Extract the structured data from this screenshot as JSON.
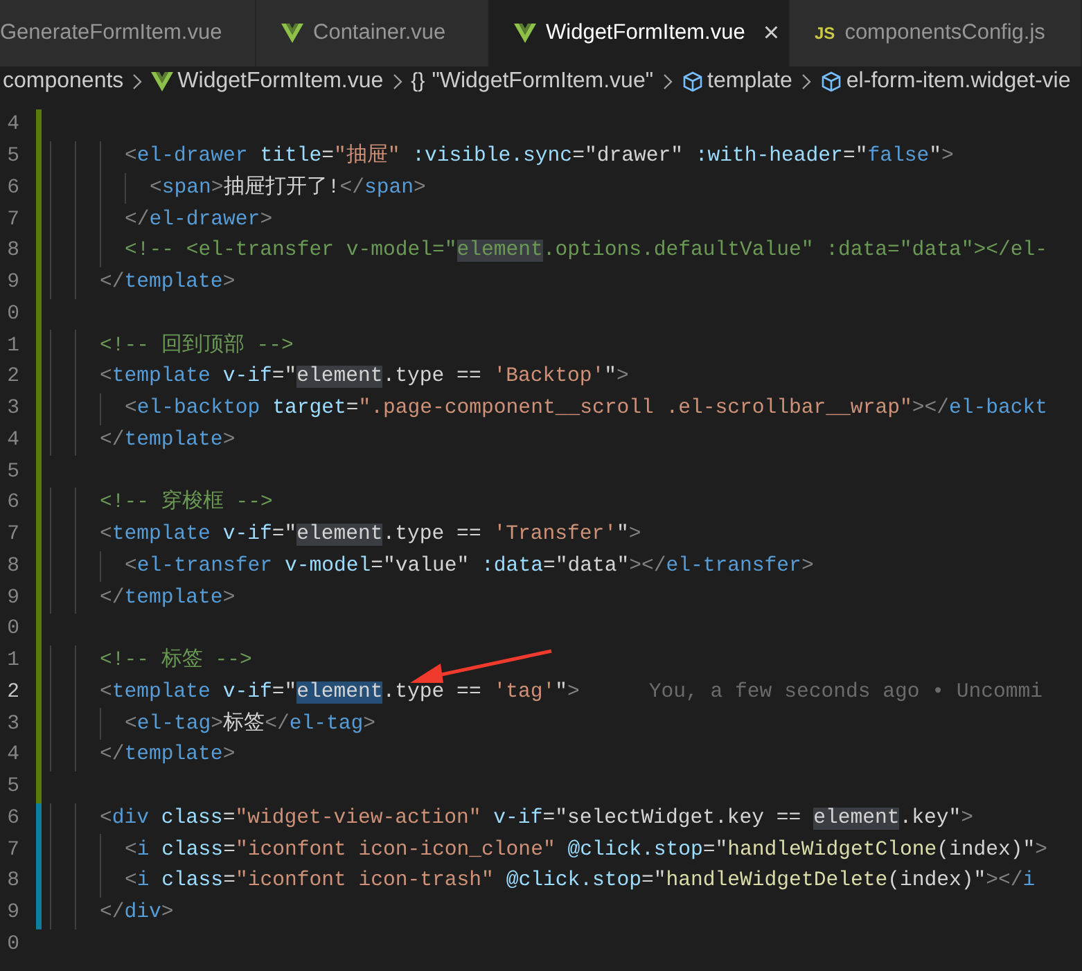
{
  "tabs": [
    {
      "label": "GenerateFormItem.vue",
      "kind": "plain",
      "selected": false
    },
    {
      "label": "Container.vue",
      "kind": "vue",
      "selected": false
    },
    {
      "label": "WidgetFormItem.vue",
      "kind": "vue",
      "selected": true,
      "close": "×"
    },
    {
      "label": "componentsConfig.js",
      "kind": "js",
      "icon_text": "JS",
      "selected": false
    }
  ],
  "breadcrumbs": [
    {
      "label": "components",
      "kind": "plain"
    },
    {
      "label": "WidgetFormItem.vue",
      "kind": "vue"
    },
    {
      "label": "\"WidgetFormItem.vue\"",
      "kind": "text",
      "icon_text": "{}"
    },
    {
      "label": "template",
      "kind": "cube"
    },
    {
      "label": "el-form-item.widget-vie",
      "kind": "cube"
    }
  ],
  "lines": [
    {
      "number": "4",
      "added": true,
      "modified": false,
      "current": false
    },
    {
      "number": "5",
      "added": true,
      "modified": false,
      "current": false,
      "tokens": [
        {
          "kind": "punct",
          "text": "      <"
        },
        {
          "kind": "tag",
          "text": "el-drawer"
        },
        {
          "kind": "attr",
          "text": " title"
        },
        {
          "kind": "text",
          "text": "="
        },
        {
          "kind": "str",
          "text": "\"抽屉\""
        },
        {
          "kind": "attr",
          "text": " :visible.sync"
        },
        {
          "kind": "text",
          "text": "=\"drawer\""
        },
        {
          "kind": "attr",
          "text": " :with-header"
        },
        {
          "kind": "text",
          "text": "=\""
        },
        {
          "kind": "kw",
          "text": "false"
        },
        {
          "kind": "text",
          "text": "\""
        },
        {
          "kind": "punct",
          "text": ">"
        }
      ]
    },
    {
      "number": "6",
      "added": true,
      "modified": false,
      "current": false,
      "tokens": [
        {
          "kind": "punct",
          "text": "        <"
        },
        {
          "kind": "tag",
          "text": "span"
        },
        {
          "kind": "punct",
          "text": ">"
        },
        {
          "kind": "text",
          "text": "抽屉打开了!"
        },
        {
          "kind": "punct",
          "text": "</"
        },
        {
          "kind": "tag",
          "text": "span"
        },
        {
          "kind": "punct",
          "text": ">"
        }
      ]
    },
    {
      "number": "7",
      "added": true,
      "modified": false,
      "current": false,
      "tokens": [
        {
          "kind": "punct",
          "text": "      </"
        },
        {
          "kind": "tag",
          "text": "el-drawer"
        },
        {
          "kind": "punct",
          "text": ">"
        }
      ]
    },
    {
      "number": "8",
      "added": true,
      "modified": false,
      "current": false,
      "tokens": [
        {
          "kind": "cmt",
          "text": "      <!-- <el-transfer v-model=\""
        },
        {
          "kind": "cmt",
          "text": "element",
          "highlighted": true,
          "selected": false
        },
        {
          "kind": "cmt",
          "text": ".options.defaultValue\" :data=\"data\"></el-"
        }
      ]
    },
    {
      "number": "9",
      "added": true,
      "modified": false,
      "current": false,
      "tokens": [
        {
          "kind": "punct",
          "text": "    </"
        },
        {
          "kind": "tag",
          "text": "template"
        },
        {
          "kind": "punct",
          "text": ">"
        }
      ]
    },
    {
      "number": "0",
      "added": true,
      "modified": false,
      "current": false
    },
    {
      "number": "1",
      "added": true,
      "modified": false,
      "current": false,
      "tokens": [
        {
          "kind": "cmt",
          "text": "    <!-- 回到顶部 -->"
        }
      ]
    },
    {
      "number": "2",
      "added": true,
      "modified": false,
      "current": false,
      "tokens": [
        {
          "kind": "punct",
          "text": "    <"
        },
        {
          "kind": "tag",
          "text": "template"
        },
        {
          "kind": "attr",
          "text": " v-if"
        },
        {
          "kind": "text",
          "text": "=\""
        },
        {
          "kind": "text",
          "text": "element",
          "highlighted": true,
          "selected": false
        },
        {
          "kind": "text",
          "text": ".type == "
        },
        {
          "kind": "str",
          "text": "'Backtop'"
        },
        {
          "kind": "text",
          "text": "\""
        },
        {
          "kind": "punct",
          "text": ">"
        }
      ]
    },
    {
      "number": "3",
      "added": true,
      "modified": false,
      "current": false,
      "tokens": [
        {
          "kind": "punct",
          "text": "      <"
        },
        {
          "kind": "tag",
          "text": "el-backtop"
        },
        {
          "kind": "attr",
          "text": " target"
        },
        {
          "kind": "text",
          "text": "="
        },
        {
          "kind": "str",
          "text": "\".page-component__scroll .el-scrollbar__wrap\""
        },
        {
          "kind": "punct",
          "text": "></"
        },
        {
          "kind": "tag",
          "text": "el-backt"
        }
      ]
    },
    {
      "number": "4",
      "added": true,
      "modified": false,
      "current": false,
      "tokens": [
        {
          "kind": "punct",
          "text": "    </"
        },
        {
          "kind": "tag",
          "text": "template"
        },
        {
          "kind": "punct",
          "text": ">"
        }
      ]
    },
    {
      "number": "5",
      "added": true,
      "modified": false,
      "current": false
    },
    {
      "number": "6",
      "added": true,
      "modified": false,
      "current": false,
      "tokens": [
        {
          "kind": "cmt",
          "text": "    <!-- 穿梭框 -->"
        }
      ]
    },
    {
      "number": "7",
      "added": true,
      "modified": false,
      "current": false,
      "tokens": [
        {
          "kind": "punct",
          "text": "    <"
        },
        {
          "kind": "tag",
          "text": "template"
        },
        {
          "kind": "attr",
          "text": " v-if"
        },
        {
          "kind": "text",
          "text": "=\""
        },
        {
          "kind": "text",
          "text": "element",
          "highlighted": true,
          "selected": false
        },
        {
          "kind": "text",
          "text": ".type == "
        },
        {
          "kind": "str",
          "text": "'Transfer'"
        },
        {
          "kind": "text",
          "text": "\""
        },
        {
          "kind": "punct",
          "text": ">"
        }
      ]
    },
    {
      "number": "8",
      "added": true,
      "modified": false,
      "current": false,
      "tokens": [
        {
          "kind": "punct",
          "text": "      <"
        },
        {
          "kind": "tag",
          "text": "el-transfer"
        },
        {
          "kind": "attr",
          "text": " v-model"
        },
        {
          "kind": "text",
          "text": "=\"value\""
        },
        {
          "kind": "attr",
          "text": " :data"
        },
        {
          "kind": "text",
          "text": "=\"data\""
        },
        {
          "kind": "punct",
          "text": "></"
        },
        {
          "kind": "tag",
          "text": "el-transfer"
        },
        {
          "kind": "punct",
          "text": ">"
        }
      ]
    },
    {
      "number": "9",
      "added": true,
      "modified": false,
      "current": false,
      "tokens": [
        {
          "kind": "punct",
          "text": "    </"
        },
        {
          "kind": "tag",
          "text": "template"
        },
        {
          "kind": "punct",
          "text": ">"
        }
      ]
    },
    {
      "number": "0",
      "added": true,
      "modified": false,
      "current": false
    },
    {
      "number": "1",
      "added": true,
      "modified": false,
      "current": false,
      "tokens": [
        {
          "kind": "cmt",
          "text": "    <!-- 标签 -->"
        }
      ]
    },
    {
      "number": "2",
      "added": true,
      "modified": false,
      "current": true,
      "tokens": [
        {
          "kind": "punct",
          "text": "    <"
        },
        {
          "kind": "tag",
          "text": "template"
        },
        {
          "kind": "attr",
          "text": " v-if"
        },
        {
          "kind": "text",
          "text": "=\""
        },
        {
          "kind": "text",
          "text": "element",
          "highlighted": true,
          "selected": true
        },
        {
          "kind": "text",
          "text": ".type == "
        },
        {
          "kind": "str",
          "text": "'tag'"
        },
        {
          "kind": "text",
          "text": "\""
        },
        {
          "kind": "punct",
          "text": ">"
        }
      ],
      "blame": "You, a few seconds ago • Uncommi"
    },
    {
      "number": "3",
      "added": true,
      "modified": false,
      "current": false,
      "tokens": [
        {
          "kind": "punct",
          "text": "      <"
        },
        {
          "kind": "tag",
          "text": "el-tag"
        },
        {
          "kind": "punct",
          "text": ">"
        },
        {
          "kind": "text",
          "text": "标签"
        },
        {
          "kind": "punct",
          "text": "</"
        },
        {
          "kind": "tag",
          "text": "el-tag"
        },
        {
          "kind": "punct",
          "text": ">"
        }
      ]
    },
    {
      "number": "4",
      "added": true,
      "modified": false,
      "current": false,
      "tokens": [
        {
          "kind": "punct",
          "text": "    </"
        },
        {
          "kind": "tag",
          "text": "template"
        },
        {
          "kind": "punct",
          "text": ">"
        }
      ]
    },
    {
      "number": "5",
      "added": true,
      "modified": false,
      "current": false
    },
    {
      "number": "6",
      "added": false,
      "modified": true,
      "current": false,
      "tokens": [
        {
          "kind": "punct",
          "text": "    <"
        },
        {
          "kind": "tag",
          "text": "div"
        },
        {
          "kind": "attr",
          "text": " class"
        },
        {
          "kind": "text",
          "text": "="
        },
        {
          "kind": "str",
          "text": "\"widget-view-action\""
        },
        {
          "kind": "attr",
          "text": " v-if"
        },
        {
          "kind": "text",
          "text": "=\"selectWidget.key == "
        },
        {
          "kind": "text",
          "text": "element",
          "highlighted": true,
          "selected": false
        },
        {
          "kind": "text",
          "text": ".key\""
        },
        {
          "kind": "punct",
          "text": ">"
        }
      ]
    },
    {
      "number": "7",
      "added": false,
      "modified": true,
      "current": false,
      "tokens": [
        {
          "kind": "punct",
          "text": "      <"
        },
        {
          "kind": "tag",
          "text": "i"
        },
        {
          "kind": "attr",
          "text": " class"
        },
        {
          "kind": "text",
          "text": "="
        },
        {
          "kind": "str",
          "text": "\"iconfont icon-icon_clone\""
        },
        {
          "kind": "attr",
          "text": " @click.stop"
        },
        {
          "kind": "text",
          "text": "=\""
        },
        {
          "kind": "fn",
          "text": "handleWidgetClone"
        },
        {
          "kind": "text",
          "text": "(index)\""
        },
        {
          "kind": "punct",
          "text": ">"
        }
      ]
    },
    {
      "number": "8",
      "added": false,
      "modified": true,
      "current": false,
      "tokens": [
        {
          "kind": "punct",
          "text": "      <"
        },
        {
          "kind": "tag",
          "text": "i"
        },
        {
          "kind": "attr",
          "text": " class"
        },
        {
          "kind": "text",
          "text": "="
        },
        {
          "kind": "str",
          "text": "\"iconfont icon-trash\""
        },
        {
          "kind": "attr",
          "text": " @click.stop"
        },
        {
          "kind": "text",
          "text": "=\""
        },
        {
          "kind": "fn",
          "text": "handleWidgetDelete"
        },
        {
          "kind": "text",
          "text": "(index)\""
        },
        {
          "kind": "punct",
          "text": "></"
        },
        {
          "kind": "tag",
          "text": "i"
        }
      ]
    },
    {
      "number": "9",
      "added": false,
      "modified": true,
      "current": false,
      "tokens": [
        {
          "kind": "punct",
          "text": "    </"
        },
        {
          "kind": "tag",
          "text": "div"
        },
        {
          "kind": "punct",
          "text": ">"
        }
      ]
    },
    {
      "number": "0",
      "added": false,
      "modified": false,
      "current": false
    }
  ]
}
